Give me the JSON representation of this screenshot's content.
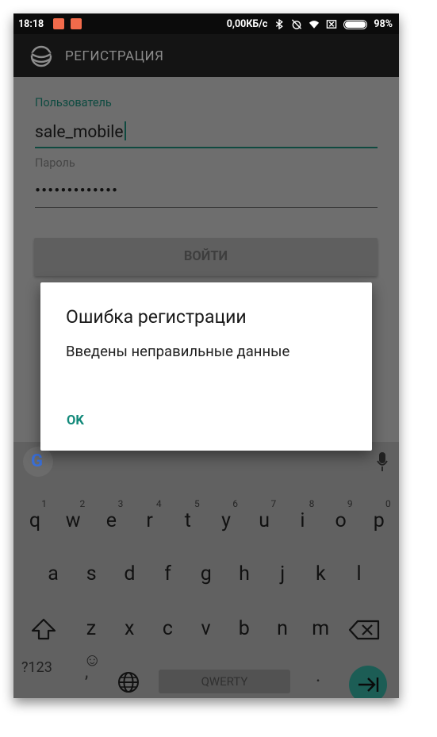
{
  "status_bar": {
    "time": "18:18",
    "network_speed": "0,00КБ/с",
    "battery": "98%",
    "battery_level": 0.98,
    "icons": [
      "notification-app-icon",
      "notification-app-icon",
      "bluetooth-icon",
      "alarm-off-icon",
      "wifi-icon",
      "sim-off-icon",
      "battery-icon"
    ]
  },
  "app_bar": {
    "title": "РЕГИСТРАЦИЯ",
    "logo_icon": "globe-logo-icon"
  },
  "form": {
    "user_label": "Пользователь",
    "user_value": "sale_mobile",
    "password_label": "Пароль",
    "password_value": "•••••••••••••",
    "login_button": "ВОЙТИ"
  },
  "dialog": {
    "title": "Ошибка регистрации",
    "message": "Введены неправильные данные",
    "ok_button": "OK",
    "accent_color": "#12897a"
  },
  "keyboard": {
    "row1": [
      {
        "key": "q",
        "hint": "1"
      },
      {
        "key": "w",
        "hint": "2"
      },
      {
        "key": "e",
        "hint": "3"
      },
      {
        "key": "r",
        "hint": "4"
      },
      {
        "key": "t",
        "hint": "5"
      },
      {
        "key": "y",
        "hint": "6"
      },
      {
        "key": "u",
        "hint": "7"
      },
      {
        "key": "i",
        "hint": "8"
      },
      {
        "key": "o",
        "hint": "9"
      },
      {
        "key": "p",
        "hint": "0"
      }
    ],
    "row2": [
      "a",
      "s",
      "d",
      "f",
      "g",
      "h",
      "j",
      "k",
      "l"
    ],
    "row3": [
      "z",
      "x",
      "c",
      "v",
      "b",
      "n",
      "m"
    ],
    "symbols_key": "?123",
    "emoji_key": "☺",
    "comma_key": ",",
    "space_label": "QWERTY",
    "period_key": "."
  }
}
